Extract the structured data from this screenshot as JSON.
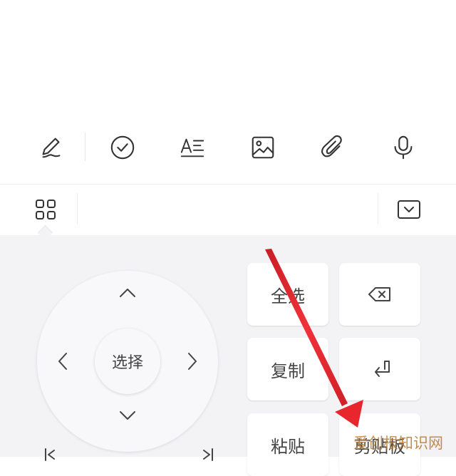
{
  "toolbar": {
    "icons": [
      "pen-icon",
      "check-circle-icon",
      "text-format-icon",
      "image-icon",
      "paperclip-icon",
      "microphone-icon"
    ]
  },
  "keyboard_top": {
    "icons": [
      "grid-icon",
      "keyboard-collapse-icon"
    ]
  },
  "dpad": {
    "select_label": "选择",
    "icons": [
      "arrow-up-icon",
      "arrow-left-icon",
      "arrow-right-icon",
      "arrow-down-icon"
    ]
  },
  "keys": {
    "select_all": "全选",
    "copy": "复制",
    "paste": "粘贴",
    "clipboard": "剪贴板",
    "icons": [
      "backspace-icon",
      "enter-icon"
    ]
  },
  "annotation": {
    "arrow_color": "#e8262e"
  },
  "watermark": {
    "text": "爱创根知识网"
  },
  "colors": {
    "panel_bg": "#f3f3f6",
    "key_bg": "#ffffff",
    "icon_stroke": "#333333"
  }
}
